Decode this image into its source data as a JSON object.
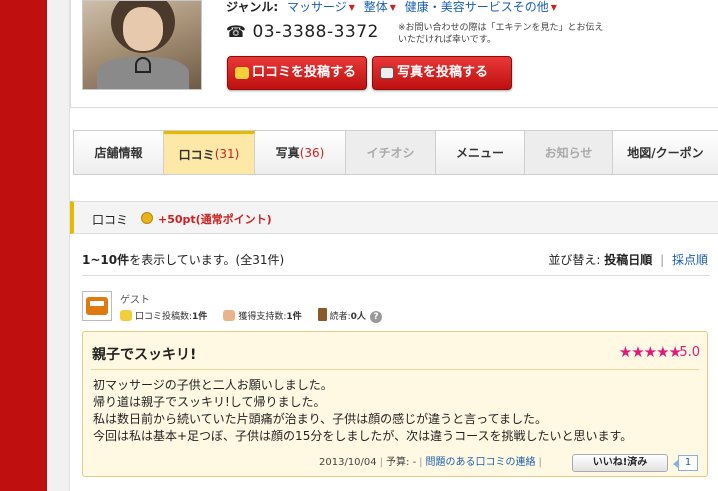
{
  "shop": {
    "genre_label": "ジャンル:",
    "genres": [
      "マッサージ",
      "整体",
      "健康・美容サービスその他"
    ],
    "phone": "03-3388-3372",
    "phone_note": "※お問い合わせの際は「エキテンを見た」とお伝えいただければ幸いです。",
    "buttons": {
      "review": "口コミを投稿する",
      "photo": "写真を投稿する"
    }
  },
  "tabs": [
    {
      "label": "店舗情報",
      "count": "",
      "state": "normal"
    },
    {
      "label": "口コミ",
      "count": "(31)",
      "state": "active"
    },
    {
      "label": "写真",
      "count": "(36)",
      "state": "normal"
    },
    {
      "label": "イチオシ",
      "count": "",
      "state": "disabled"
    },
    {
      "label": "メニュー",
      "count": "",
      "state": "normal"
    },
    {
      "label": "お知らせ",
      "count": "",
      "state": "disabled"
    },
    {
      "label": "地図/クーポン",
      "count": "",
      "state": "normal"
    }
  ],
  "section": {
    "title": "口コミ",
    "points": "+50pt(通常ポイント)"
  },
  "listing": {
    "range": "1~10件",
    "range_suffix": "を表示しています。(全31件)",
    "sort_label": "並び替え:",
    "sort_current": "投稿日順",
    "sort_other": "採点順"
  },
  "review": {
    "author": "ゲスト",
    "stats": {
      "posts_label": "口コミ投稿数:",
      "posts": "1件",
      "support_label": "獲得支持数:",
      "support": "1件",
      "readers_label": "読者:",
      "readers": "0人"
    },
    "title": "親子でスッキリ!",
    "stars": "★★★★★",
    "score": "5.0",
    "body": [
      "初マッサージの子供と二人お願いしました。",
      "帰り道は親子でスッキリ!して帰りました。",
      "私は数日前から続いていた片頭痛が治まり、子供は顔の感じが違うと言ってました。",
      "今回は私は基本+足つぼ、子供は顔の15分をしましたが、次は違うコースを挑戦したいと思います。"
    ],
    "date": "2013/10/04",
    "budget": "予算: -",
    "report_link": "問題のある口コミの連絡",
    "like_label": "いいね!済み",
    "like_count": "1"
  },
  "colors": {
    "brand_red": "#c00f0f",
    "accent_yellow": "#e6b800",
    "link_blue": "#1a5fb4",
    "star_pink": "#e0197d"
  }
}
